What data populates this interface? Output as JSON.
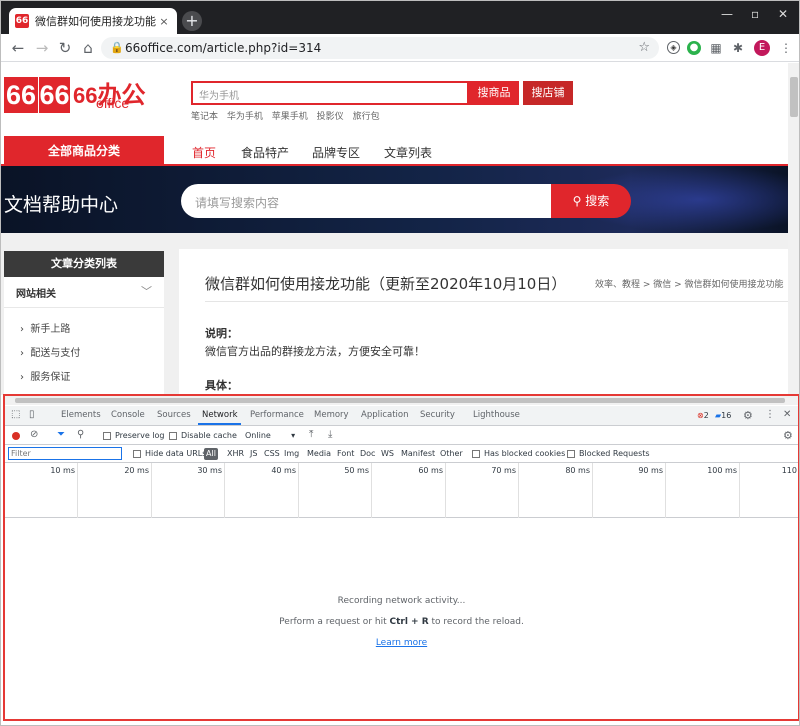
{
  "browser": {
    "tab_title": "微信群如何使用接龙功能（更新至",
    "tab_close": "×",
    "new_tab": "+",
    "url": "66office.com/article.php?id=314",
    "avatar_letter": "E"
  },
  "site": {
    "logo_number": "66",
    "logo_box_1": "66",
    "logo_text": "办公",
    "logo_sub": "office",
    "search_placeholder": "华为手机",
    "search_goods_btn": "搜商品",
    "search_shop_btn": "搜店铺",
    "hot_links": [
      "笔记本",
      "华为手机",
      "苹果手机",
      "投影仪",
      "旅行包"
    ],
    "category_btn": "全部商品分类",
    "nav": [
      "首页",
      "食品特产",
      "品牌专区",
      "文章列表"
    ],
    "banner_title": "文档帮助中心",
    "banner_search_placeholder": "请填写搜索内容",
    "banner_search_btn": "搜索",
    "sidebar_title": "文章分类列表",
    "sidebar_group": "网站相关",
    "sidebar_items": [
      "新手上路",
      "配送与支付",
      "服务保证"
    ],
    "article_title": "微信群如何使用接龙功能（更新至2020年10月10日）",
    "breadcrumb": "效率、教程  >  微信  >  微信群如何使用接龙功能（",
    "desc_label": "说明：",
    "desc_text": "微信官方出品的群接龙方法，方便安全可靠！",
    "detail_label": "具体："
  },
  "devtools": {
    "tabs": [
      "Elements",
      "Console",
      "Sources",
      "Network",
      "Performance",
      "Memory",
      "Application",
      "Security",
      "Lighthouse"
    ],
    "active_tab": "Network",
    "errors": "2",
    "messages": "16",
    "preserve_log": "Preserve log",
    "disable_cache": "Disable cache",
    "throttle": "Online",
    "filter_placeholder": "Filter",
    "hide_data_urls": "Hide data URLs",
    "types": [
      "All",
      "XHR",
      "JS",
      "CSS",
      "Img",
      "Media",
      "Font",
      "Doc",
      "WS",
      "Manifest",
      "Other"
    ],
    "blocked_cookies": "Has blocked cookies",
    "blocked_requests": "Blocked Requests",
    "ticks": [
      "10 ms",
      "20 ms",
      "30 ms",
      "40 ms",
      "50 ms",
      "60 ms",
      "70 ms",
      "80 ms",
      "90 ms",
      "100 ms",
      "110"
    ],
    "empty_line1": "Recording network activity...",
    "empty_line2_pre": "Perform a request or hit",
    "empty_line2_keys": "Ctrl + R",
    "empty_line2_post": "to record the reload.",
    "learn_more": "Learn more"
  },
  "colors": {
    "brand_red": "#e0262c",
    "devtools_border": "#e53935",
    "link_blue": "#1a73e8"
  }
}
